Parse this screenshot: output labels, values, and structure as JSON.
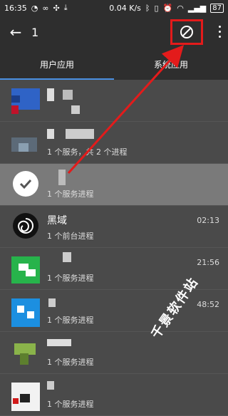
{
  "status": {
    "time": "16:35",
    "speed": "0.04",
    "speed_unit": "K/s",
    "battery": "87"
  },
  "appbar": {
    "count": "1"
  },
  "tabs": [
    {
      "label": "用户应用"
    },
    {
      "label": "系统应用"
    }
  ],
  "rows": [
    {
      "title": "",
      "sub": "",
      "time": ""
    },
    {
      "title": "",
      "sub": "1 个服务，共 2 个进程",
      "time": ""
    },
    {
      "title": "",
      "sub": "1 个服务进程",
      "time": ""
    },
    {
      "title": "黑域",
      "sub": "1 个前台进程",
      "time": "02:13"
    },
    {
      "title": "",
      "sub": "1 个服务进程",
      "time": "21:56"
    },
    {
      "title": "",
      "sub": "1 个服务进程",
      "time": "48:52"
    },
    {
      "title": "",
      "sub": "1 个服务进程",
      "time": ""
    },
    {
      "title": "",
      "sub": "1 个服务进程",
      "time": ""
    }
  ],
  "watermark": "千景软件站",
  "colors": {
    "highlight": "#e31b1b",
    "tab_indicator": "#4a90e2"
  }
}
